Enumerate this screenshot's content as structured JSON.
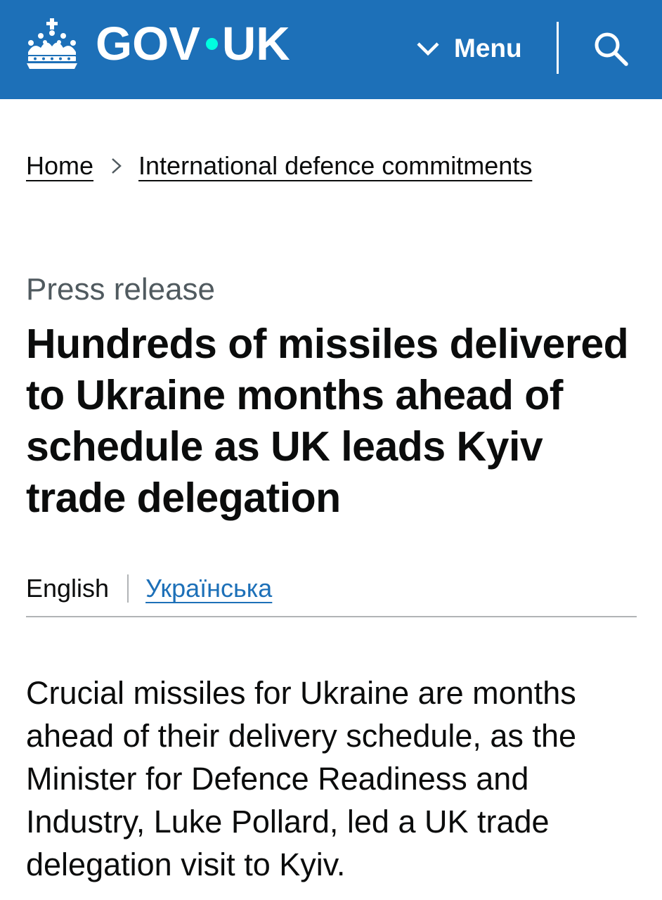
{
  "header": {
    "logo_text_left": "GOV",
    "logo_text_right": "UK",
    "menu_label": "Menu",
    "search_icon": "search-icon",
    "colors": {
      "background": "#1d70b8",
      "logo_dot": "#00ffe0",
      "text": "#ffffff"
    }
  },
  "breadcrumb": {
    "items": [
      {
        "label": "Home"
      },
      {
        "label": "International defence commitments"
      }
    ]
  },
  "article": {
    "caption": "Press release",
    "title": "Hundreds of missiles delivered to Ukraine months ahead of schedule as UK leads Kyiv trade delegation",
    "languages": {
      "current": "English",
      "alternate": "Українська"
    },
    "lead": "Crucial missiles for Ukraine are months ahead of their delivery schedule, as the Minister for Defence Readiness and Industry, Luke Pollard, led a UK trade delegation visit to Kyiv."
  }
}
